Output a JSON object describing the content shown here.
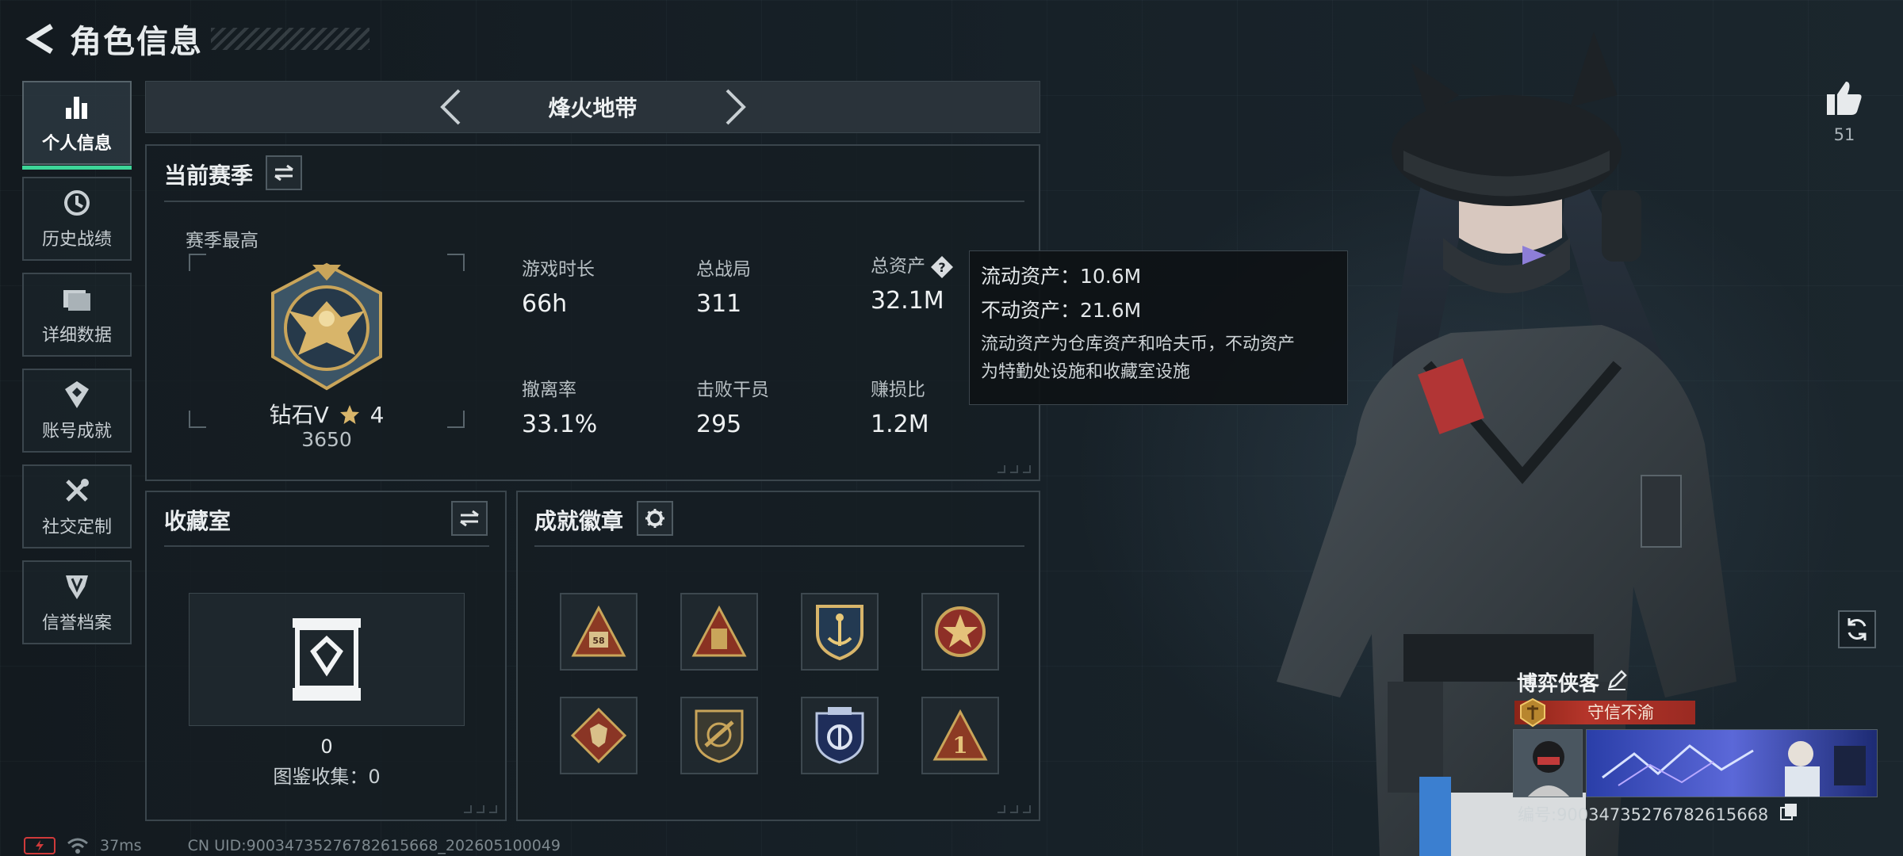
{
  "header": {
    "title": "角色信息"
  },
  "sidebar": {
    "items": [
      {
        "label": "个人信息",
        "icon": "bar-chart-icon",
        "active": true
      },
      {
        "label": "历史战绩",
        "icon": "clock-icon"
      },
      {
        "label": "详细数据",
        "icon": "folder-icon"
      },
      {
        "label": "账号成就",
        "icon": "achievement-icon"
      },
      {
        "label": "社交定制",
        "icon": "tools-icon"
      },
      {
        "label": "信誉档案",
        "icon": "shield-icon"
      }
    ]
  },
  "mode": {
    "title": "烽火地带"
  },
  "season": {
    "title": "当前赛季",
    "best_label": "赛季最高",
    "rank_name": "钻石V",
    "rank_stars": "4",
    "rank_score": "3650",
    "stats": [
      {
        "label": "游戏时长",
        "value": "66h"
      },
      {
        "label": "总战局",
        "value": "311"
      },
      {
        "label": "总资产",
        "value": "32.1M"
      },
      {
        "label": "撤离率",
        "value": "33.1%"
      },
      {
        "label": "击败干员",
        "value": "295"
      },
      {
        "label": "赚损比",
        "value": "1.2M"
      }
    ]
  },
  "tooltip": {
    "liquid": "流动资产：10.6M",
    "fixed": "不动资产：21.6M",
    "desc_line1": "流动资产为仓库资产和哈夫币，不动资产",
    "desc_line2": "为特勤处设施和收藏室设施"
  },
  "collection": {
    "title": "收藏室",
    "count": "0",
    "label": "图鉴收集：0"
  },
  "achievements": {
    "title": "成就徽章",
    "badges": [
      "badge-triangle-58",
      "badge-triangle-case",
      "badge-shield-anchor",
      "badge-round-star",
      "badge-diamond-wolf",
      "badge-shield-rifle",
      "badge-shield-blue",
      "badge-triangle-1"
    ]
  },
  "profile": {
    "likes": "51",
    "name": "博弈侠客",
    "title": "守信不渝",
    "id_text": "编号:9003473527678261566​8"
  },
  "status": {
    "ping": "37ms",
    "uid": "CN UID:9003473527678261566​8_202605100049"
  },
  "colors": {
    "accent_green": "#3dd598",
    "title_red": "#b5352a",
    "gold": "#c9a55a"
  }
}
